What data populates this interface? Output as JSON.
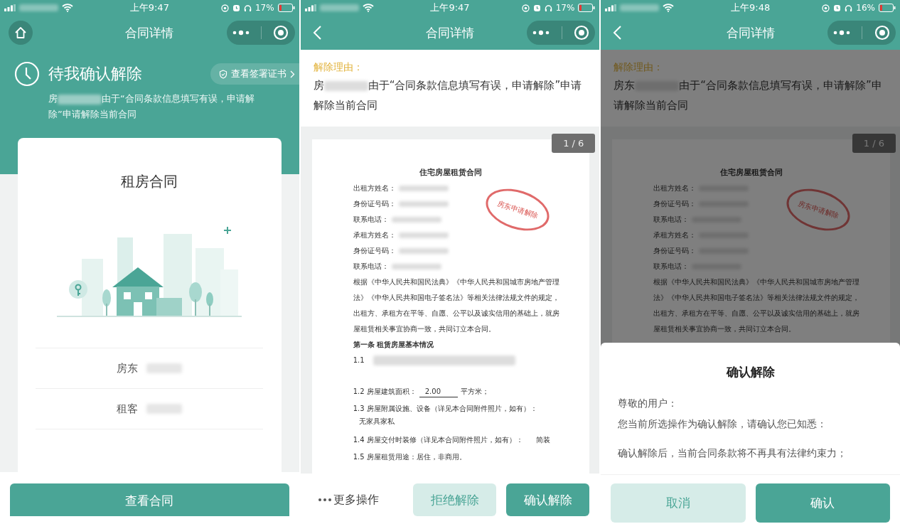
{
  "screens": [
    {
      "kind": "summary",
      "status_bar": {
        "time": "上午9:47",
        "battery": "17%"
      },
      "nav": {
        "kind": "home",
        "title": "合同详情"
      },
      "status_title": "待我确认解除",
      "certificate_link": "查看签署证书",
      "reason": {
        "before": "房",
        "after": "由于“合同条款信息填写有误，申请解除”申请解除当前合同"
      },
      "card": {
        "title": "租房合同",
        "parties": [
          {
            "role": "房东"
          },
          {
            "role": "租客"
          }
        ]
      },
      "button": "查看合同"
    },
    {
      "kind": "document",
      "status_bar": {
        "time": "上午9:47",
        "battery": "17%"
      },
      "nav": {
        "kind": "back",
        "title": "合同详情"
      },
      "reason_label": "解除理由：",
      "reason": {
        "before": "房",
        "after": "由于“合同条款信息填写有误，申请解除”申请解除当前合同"
      },
      "page_counter": "1 / 6",
      "document": {
        "stamp": "房东申请解除",
        "lines": [
          {
            "kind": "title",
            "text": "住宅房屋租赁合同"
          },
          {
            "kind": "field",
            "text": "出租方姓名："
          },
          {
            "kind": "field",
            "text": "身份证号码："
          },
          {
            "kind": "field",
            "text": "联系电话："
          },
          {
            "kind": "field",
            "text": "承租方姓名："
          },
          {
            "kind": "field",
            "text": "身份证号码："
          },
          {
            "kind": "field",
            "text": "联系电话："
          },
          {
            "kind": "para",
            "text": "根据《中华人民共和国民法典》《中华人民共和国城市房地产管理法》《中华人民共和国电子签名法》等相关法律法规文件的规定，出租方、承租方在平等、自愿、公平以及诚实信用的基础上，就房屋租赁相关事宜协商一致，共同订立本合同。"
          },
          {
            "kind": "section",
            "text": "第一条 租赁房屋基本情况"
          },
          {
            "kind": "redacted",
            "text": "1.1"
          },
          {
            "kind": "item",
            "text": "1.2 房屋建筑面积：",
            "fill": "2.00",
            "after": "平方米；"
          },
          {
            "kind": "item",
            "text": "1.3 房屋附属设施、设备（详见本合同附件照片，如有）：",
            "sub": "无家具家私"
          },
          {
            "kind": "item",
            "text": "1.4 房屋交付时装修（详见本合同附件照片，如有）：",
            "answer": "简装"
          },
          {
            "kind": "item",
            "text": "1.5 房屋租赁用途：居住，非商用。"
          }
        ]
      },
      "actions": {
        "more": "更多操作",
        "reject": "拒绝解除",
        "confirm": "确认解除"
      }
    },
    {
      "kind": "dialog",
      "status_bar": {
        "time": "上午9:48",
        "battery": "16%"
      },
      "nav": {
        "kind": "back",
        "title": "合同详情"
      },
      "reason_label": "解除理由：",
      "reason": {
        "before": "房东",
        "after": "由于“合同条款信息填写有误，申请解除”申请解除当前合同"
      },
      "page_counter": "1 / 6",
      "document": {
        "stamp": "房东申请解除",
        "lines": [
          {
            "kind": "title",
            "text": "住宅房屋租赁合同"
          },
          {
            "kind": "field",
            "text": "出租方姓名："
          },
          {
            "kind": "field",
            "text": "身份证号码："
          },
          {
            "kind": "field",
            "text": "联系电话："
          },
          {
            "kind": "field",
            "text": "承租方姓名："
          },
          {
            "kind": "field",
            "text": "身份证号码："
          },
          {
            "kind": "field",
            "text": "联系电话："
          },
          {
            "kind": "para",
            "text": "根据《中华人民共和国民法典》《中华人民共和国城市房地产管理法》《中华人民共和国电子签名法》等相关法律法规文件的规定，出租方、承租方在平等、自愿、公平以及诚实信用的基础上，就房屋租赁相关事宜协商一致，共同订立本合同。"
          }
        ]
      },
      "dialog": {
        "title": "确认解除",
        "lines": [
          "尊敬的用户：",
          "您当前所选操作为确认解除，请确认您已知悉：",
          "确认解除后，当前合同条款将不再具有法律约束力；"
        ],
        "cancel": "取消",
        "confirm": "确认"
      }
    }
  ]
}
